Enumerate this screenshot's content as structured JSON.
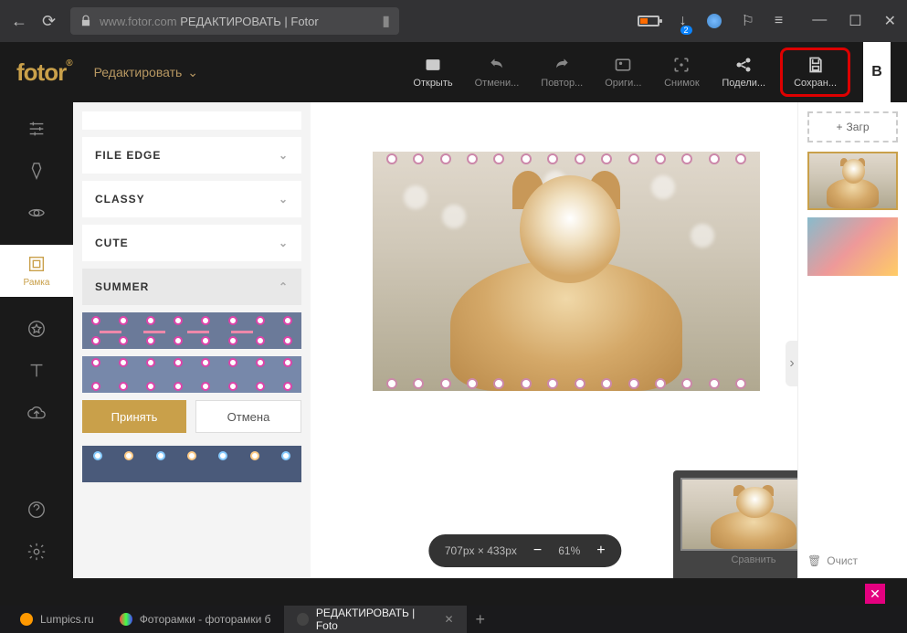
{
  "browser": {
    "url_host": "www.fotor.com",
    "url_title": "РЕДАКТИРОВАТЬ | Fotor",
    "download_badge": "2"
  },
  "app": {
    "logo": "fotor",
    "mode": "Редактировать",
    "toolbar": {
      "open": "Открыть",
      "undo": "Отмени...",
      "redo": "Повтор...",
      "original": "Ориги...",
      "snapshot": "Снимок",
      "share": "Подели...",
      "save": "Сохран..."
    },
    "header_right": "В"
  },
  "rail": {
    "frame": "Рамка"
  },
  "panel": {
    "categories": {
      "file_edge": "FILE EDGE",
      "classy": "CLASSY",
      "cute": "CUTE",
      "summer": "SUMMER"
    },
    "apply": "Принять",
    "cancel": "Отмена"
  },
  "canvas": {
    "dimensions": "707px × 433px",
    "zoom": "61%",
    "compare": "Сравнить"
  },
  "right_panel": {
    "upload": "Загр",
    "clear": "Очист"
  },
  "tabs": {
    "t1": "Lumpics.ru",
    "t2": "Фоторамки - фоторамки б",
    "t3": "РЕДАКТИРОВАТЬ | Foto"
  }
}
